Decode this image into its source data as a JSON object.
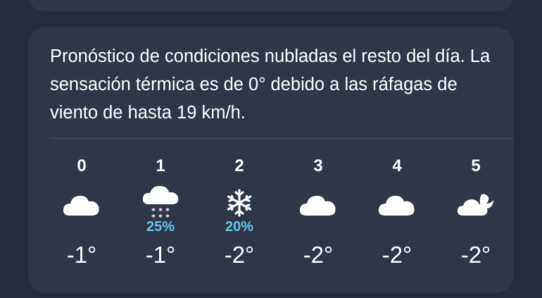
{
  "summary": "Pronóstico de condiciones nubladas el resto del día. La sensación térmica es de 0° debido a las ráfagas de viento de hasta 19 km/h.",
  "colors": {
    "background": "#262c39",
    "card": "#2f3645",
    "precip": "#64c4f6",
    "text": "#ffffff"
  },
  "hourly": [
    {
      "hour": "0",
      "icon": "cloud-icon",
      "pop": "",
      "temp": "-1°"
    },
    {
      "hour": "1",
      "icon": "cloud-snow-icon",
      "pop": "25%",
      "temp": "-1°"
    },
    {
      "hour": "2",
      "icon": "snowflake-icon",
      "pop": "20%",
      "temp": "-2°"
    },
    {
      "hour": "3",
      "icon": "cloud-icon",
      "pop": "",
      "temp": "-2°"
    },
    {
      "hour": "4",
      "icon": "cloud-icon",
      "pop": "",
      "temp": "-2°"
    },
    {
      "hour": "5",
      "icon": "cloud-moon-icon",
      "pop": "",
      "temp": "-2°"
    }
  ]
}
